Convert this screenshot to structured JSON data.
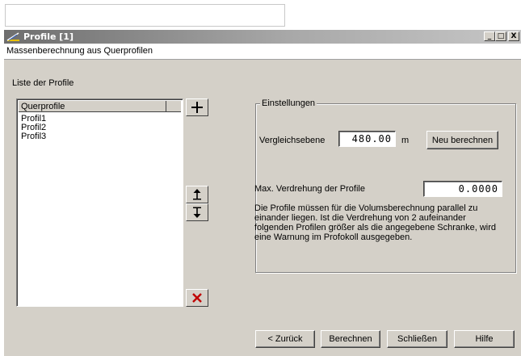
{
  "window": {
    "title": "Profile [1]",
    "subtitle": "Massenberechnung aus Querprofilen",
    "controls": {
      "minimize": "_",
      "maximize": "□",
      "close": "X"
    }
  },
  "left": {
    "list_label": "Liste der Profile",
    "list_column_header": "Querprofile",
    "items": [
      "Profil1",
      "Profil2",
      "Profil3"
    ]
  },
  "buttons": {
    "add_icon": "plus-icon",
    "move_up_icon": "arrow-up-icon",
    "move_down_icon": "arrow-down-icon",
    "delete_icon": "delete-x-icon"
  },
  "settings": {
    "legend": "Einstellungen",
    "vergleich_label": "Vergleichsebene",
    "vergleich_value": "480.00",
    "vergleich_unit": "m",
    "neu_berechnen": "Neu berechnen",
    "verdrehung_label": "Max. Verdrehung der Profile",
    "verdrehung_value": "0.0000",
    "description": "Die Profile müssen für die Volumsberechnung parallel zu einander liegen. Ist die Verdrehung von 2 aufeinander folgenden Profilen größer als die angegebene Schranke, wird eine Warnung im Profokoll ausgegeben."
  },
  "footer": {
    "back": "< Zurück",
    "calculate": "Berechnen",
    "close": "Schließen",
    "help": "Hilfe"
  },
  "colors": {
    "delete_red": "#c00000",
    "titlebar": "#7a7a7a"
  }
}
